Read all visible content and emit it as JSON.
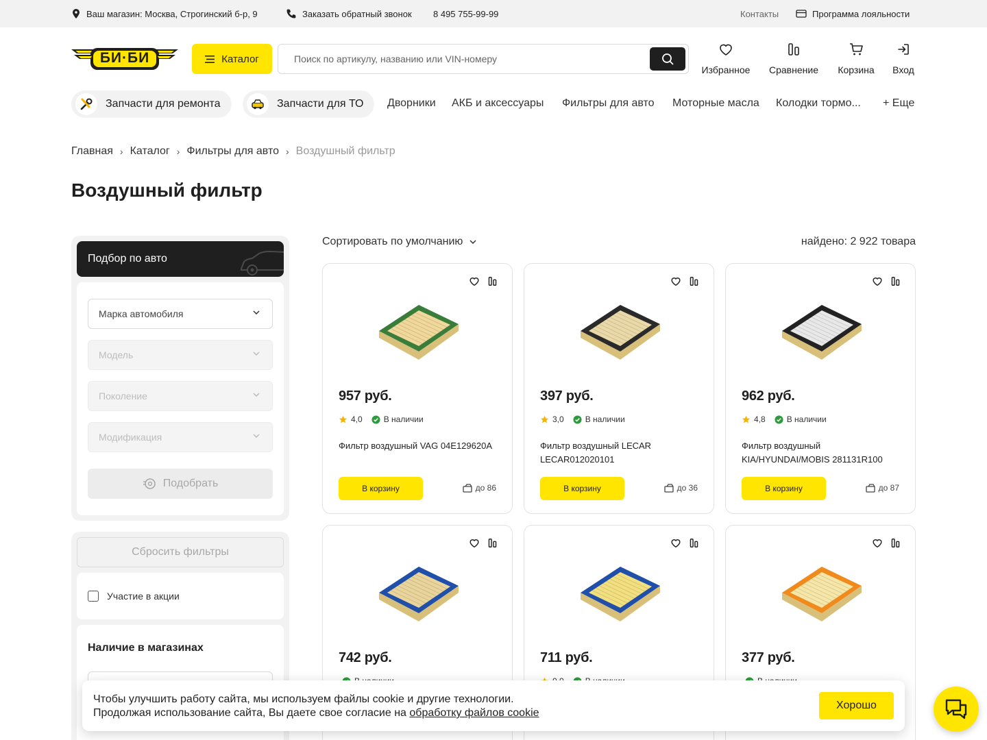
{
  "colors": {
    "accent": "#ffe500",
    "dark": "#1f1f1f",
    "panel": "#f2f2f2",
    "stock_green": "#2a9d3a",
    "star": "#f4b400"
  },
  "topbar": {
    "store": "Ваш магазин: Москва, Строгинский б-р, 9",
    "callback": "Заказать обратный звонок",
    "phone": "8 495 755-99-99",
    "contacts": "Контакты",
    "loyalty": "Программа лояльности"
  },
  "header": {
    "logo_text": "БИ·БИ",
    "catalog": "Каталог",
    "search_placeholder": "Поиск по артикулу, названию или VIN-номеру",
    "favorites": "Избранное",
    "compare": "Сравнение",
    "cart": "Корзина",
    "login": "Вход"
  },
  "nav": {
    "pill1": "Запчасти для ремонта",
    "pill2": "Запчасти для ТО",
    "links": [
      "Дворники",
      "АКБ и аксессуары",
      "Фильтры для авто",
      "Моторные масла",
      "Колодки тормо...",
      "+ Еще"
    ]
  },
  "breadcrumb": [
    "Главная",
    "Каталог",
    "Фильтры для авто",
    "Воздушный фильтр"
  ],
  "page_title": "Воздушный фильтр",
  "sidebar": {
    "car_title": "Подбор по авто",
    "brand": "Марка автомобиля",
    "model": "Модель",
    "generation": "Поколение",
    "modification": "Модификация",
    "pick": "Подобрать",
    "reset": "Сбросить фильтры",
    "promo": "Участие в акции",
    "stores": "Наличие в магазинах"
  },
  "listing": {
    "sort": "Сортировать по умолчанию",
    "found": "найдено: 2 922 товара"
  },
  "products": [
    {
      "price": "957 руб.",
      "rating": "4,0",
      "stock": "В наличии",
      "name": "Фильтр воздушный VAG 04E129620A",
      "cart": "В корзину",
      "qty": "до 86",
      "frame": "#3a7d3a",
      "fill": "#f0d79a",
      "icon": "panel-filter-image"
    },
    {
      "price": "397 руб.",
      "rating": "3,0",
      "stock": "В наличии",
      "name": "Фильтр воздушный LECAR LECAR012020101",
      "cart": "В корзину",
      "qty": "до 36",
      "frame": "#2a2a2a",
      "fill": "#ead9a8",
      "icon": "panel-filter-image"
    },
    {
      "price": "962 руб.",
      "rating": "4,8",
      "stock": "В наличии",
      "name": "Фильтр воздушный KIA/HYUNDAI/MOBIS 281131R100",
      "cart": "В корзину",
      "qty": "до 87",
      "frame": "#222222",
      "fill": "#e8e8e8",
      "icon": "panel-filter-image"
    },
    {
      "price": "742 руб.",
      "rating": "",
      "stock": "В наличии",
      "name": "",
      "cart": "",
      "qty": "",
      "frame": "#1f4fa8",
      "fill": "#e9d49b",
      "icon": "panel-filter-image"
    },
    {
      "price": "711 руб.",
      "rating": "0,0",
      "stock": "В наличии",
      "name": "",
      "cart": "",
      "qty": "",
      "frame": "#1f4fa8",
      "fill": "#f2e080",
      "icon": "panel-filter-image"
    },
    {
      "price": "377 руб.",
      "rating": "",
      "stock": "В наличии",
      "name": "",
      "cart": "",
      "qty": "",
      "frame": "#f08a1c",
      "fill": "#f6e7a8",
      "icon": "panel-filter-image"
    }
  ],
  "cookie": {
    "line1": "Чтобы улучшить работу сайта, мы используем файлы cookie и другие технологии.",
    "line2_prefix": "Продолжая использование сайта, Вы даете свое согласие на ",
    "line2_link": "обработку файлов cookie",
    "ok": "Хорошо"
  }
}
